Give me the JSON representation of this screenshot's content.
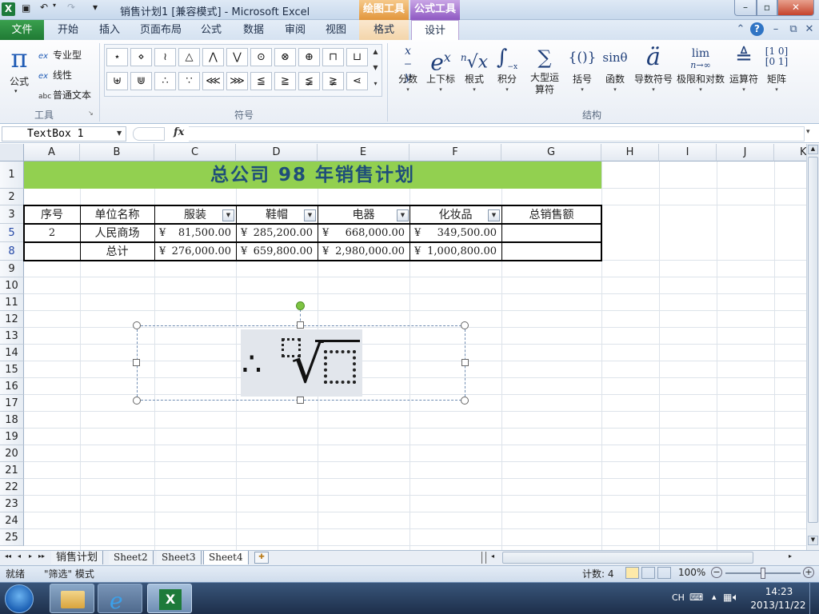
{
  "window": {
    "title": "销售计划1  [兼容模式] - Microsoft Excel",
    "context_groups": {
      "draw_tools": "绘图工具",
      "formula_tools": "公式工具"
    },
    "controls": {
      "minimize": "–",
      "maximize": "▫",
      "close": "✕"
    }
  },
  "qat": {
    "save": "💾",
    "undo": "↶",
    "redo": "↷",
    "customize": "▾"
  },
  "tabs": [
    "文件",
    "开始",
    "插入",
    "页面布局",
    "公式",
    "数据",
    "审阅",
    "视图",
    "格式",
    "设计"
  ],
  "ribbon_right": {
    "collapse": "⌃",
    "help": "?",
    "min": "–",
    "restore": "⧉",
    "close": "✕"
  },
  "ribbon": {
    "tools_group": {
      "label": "工具",
      "formula": "公式",
      "formula_caret": "▾",
      "professional": "专业型",
      "linear": "线性",
      "plain_text": "普通文本",
      "launcher": "↘"
    },
    "symbols_group": {
      "label": "符号",
      "row1": [
        "⋆",
        "⋄",
        "≀",
        "△",
        "⋀",
        "⋁",
        "⊙",
        "⊗",
        "⊕",
        "⊓",
        "⊔"
      ],
      "row2": [
        "⊎",
        "⋓",
        "∴",
        "∵",
        "⋘",
        "⋙",
        "≦",
        "≧",
        "≨",
        "≩",
        "⋖"
      ],
      "scroll": [
        "▲",
        "▼",
        "▾"
      ]
    },
    "structures_group": {
      "label": "结构",
      "items": [
        {
          "icon": "x⁄y",
          "label": "分数"
        },
        {
          "icon": "eˣ",
          "label": "上下标"
        },
        {
          "icon": "ⁿ√x",
          "label": "根式"
        },
        {
          "icon": "∫ˣ₋ₓ",
          "label": "积分"
        },
        {
          "icon": "∑",
          "label": "大型运算符"
        },
        {
          "icon": "{()}",
          "label": "括号"
        },
        {
          "icon": "sinθ",
          "label": "函数"
        },
        {
          "icon": "ä",
          "label": "导数符号"
        },
        {
          "icon": "lim",
          "label": "极限和对数"
        },
        {
          "icon": "≜",
          "label": "运算符"
        },
        {
          "icon": "[10;01]",
          "label": "矩阵"
        }
      ],
      "limit_sub": "n→∞",
      "caret": "▾"
    }
  },
  "formula_bar": {
    "name_box": "TextBox 1",
    "fx": "fx",
    "value": ""
  },
  "columns": [
    "A",
    "B",
    "C",
    "D",
    "E",
    "F",
    "G",
    "H",
    "I",
    "J",
    "K"
  ],
  "rows": [
    "1",
    "2",
    "3",
    "5",
    "8",
    "9",
    "10",
    "11",
    "12",
    "13",
    "14",
    "15",
    "16",
    "17",
    "18",
    "19",
    "20",
    "21",
    "22",
    "23",
    "24",
    "25"
  ],
  "sheet": {
    "title": "总公司 98 年销售计划",
    "headers": [
      "序号",
      "单位名称",
      "服装",
      "鞋帽",
      "电器",
      "化妆品",
      "总销售额"
    ],
    "row5": {
      "seq": "2",
      "name": "人民商场",
      "c": "81,500.00",
      "d": "285,200.00",
      "e": "668,000.00",
      "f": "349,500.00"
    },
    "row8": {
      "name": "总计",
      "c": "276,000.00",
      "d": "659,800.00",
      "e": "2,980,000.00",
      "f": "1,000,800.00"
    },
    "currency": "¥"
  },
  "equation": {
    "dots": "∴",
    "radical": "√"
  },
  "sheet_tabs": {
    "nav": [
      "◂◂",
      "◂",
      "▸",
      "▸▸"
    ],
    "tabs": [
      "销售计划",
      "Sheet2",
      "Sheet3",
      "Sheet4"
    ],
    "active": "Sheet4"
  },
  "status": {
    "ready": "就绪",
    "filter_mode": "\"筛选\" 模式",
    "count": "计数: 4",
    "zoom": "100%",
    "zoom_level": 0.5
  },
  "taskbar": {
    "lang": "CH",
    "time": "14:23",
    "date": "2013/11/22"
  }
}
